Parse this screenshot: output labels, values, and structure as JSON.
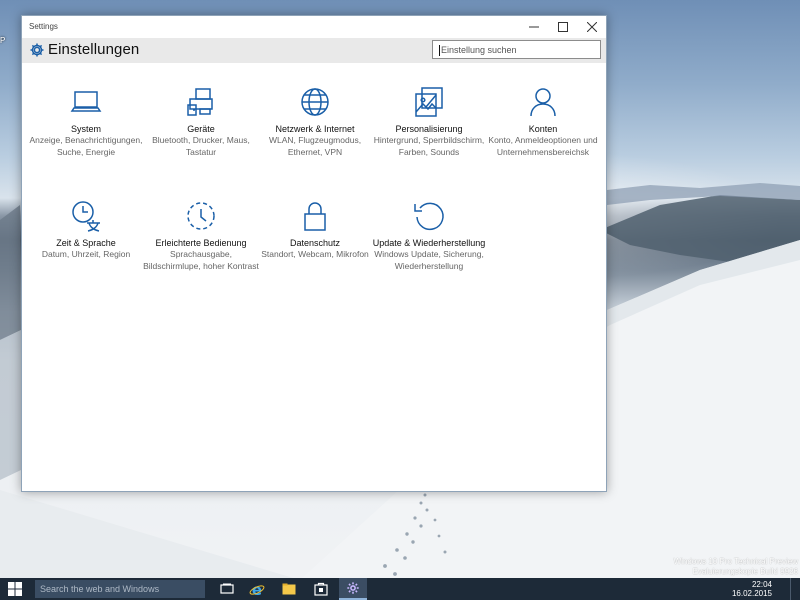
{
  "desktop": {
    "label": "P"
  },
  "window": {
    "title": "Settings",
    "controls": {
      "minimize": "minimize",
      "maximize": "maximize",
      "close": "close"
    }
  },
  "header": {
    "icon": "gear-icon",
    "title": "Einstellungen",
    "search_placeholder": "Einstellung suchen"
  },
  "categories": [
    {
      "icon": "laptop-icon",
      "label": "System",
      "desc": "Anzeige, Benachrichtigungen, Suche, Energie"
    },
    {
      "icon": "devices-icon",
      "label": "Geräte",
      "desc": "Bluetooth, Drucker, Maus, Tastatur"
    },
    {
      "icon": "globe-icon",
      "label": "Netzwerk & Internet",
      "desc": "WLAN, Flugzeugmodus, Ethernet, VPN"
    },
    {
      "icon": "paint-icon",
      "label": "Personalisierung",
      "desc": "Hintergrund, Sperrbildschirm, Farben, Sounds"
    },
    {
      "icon": "person-icon",
      "label": "Konten",
      "desc": "Konto, Anmeldeoptionen und Unternehmensbereichsk"
    },
    {
      "icon": "clock-language-icon",
      "label": "Zeit & Sprache",
      "desc": "Datum, Uhrzeit, Region"
    },
    {
      "icon": "ease-of-access-icon",
      "label": "Erleichterte Bedienung",
      "desc": "Sprachausgabe, Bildschirmlupe, hoher Kontrast"
    },
    {
      "icon": "lock-icon",
      "label": "Datenschutz",
      "desc": "Standort, Webcam, Mikrofon"
    },
    {
      "icon": "update-icon",
      "label": "Update & Wiederherstellung",
      "desc": "Windows Update, Sicherung, Wiederherstellung"
    }
  ],
  "taskbar": {
    "search_placeholder": "Search the web and Windows",
    "apps": [
      "task-view-icon",
      "internet-explorer-icon",
      "file-explorer-icon",
      "store-icon",
      "settings-icon"
    ],
    "active_app": "settings-icon",
    "time": "22:04",
    "date": "16.02.2015"
  },
  "watermark": {
    "line1": "Windows 10 Pro Technical Preview",
    "line2": "Evaluierungskopie Build 9926"
  },
  "colors": {
    "accent": "#1a5fa8",
    "taskbar": "#1d2a38",
    "header_bg": "#e9e9e9"
  }
}
